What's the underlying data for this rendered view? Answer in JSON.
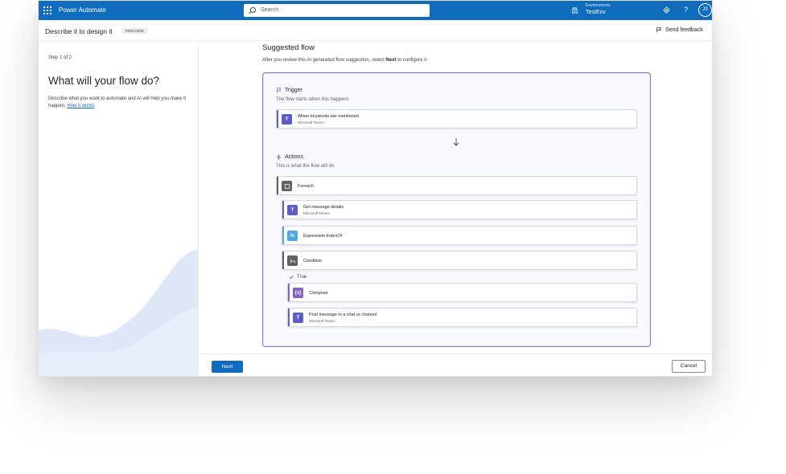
{
  "topbar": {
    "app_title": "Power Automate",
    "search_placeholder": "Search",
    "environments_label": "Environments",
    "environment_name": "TestEnv",
    "help_glyph": "?",
    "avatar_initials": "JS"
  },
  "header": {
    "page_title": "Describe it to design it",
    "preview_badge": "PREVIEW",
    "feedback_label": "Send feedback"
  },
  "left": {
    "step": "Step 1 of 2",
    "question": "What will your flow do?",
    "description": "Describe what you want to automate and AI will help you make it happen.",
    "link": "How it works"
  },
  "main": {
    "title": "Suggested flow",
    "subtitle_before": "After you review this AI generated flow suggestion, select ",
    "subtitle_bold": "Next",
    "subtitle_after": " to configure it"
  },
  "trigger": {
    "heading": "Trigger",
    "sub": "The flow starts when this happens",
    "card_title": "When keywords are mentioned",
    "card_sub": "Microsoft Teams"
  },
  "actions": {
    "heading": "Actions",
    "sub": "This is what the flow will do",
    "items": [
      {
        "title": "Foreach",
        "sub": ""
      },
      {
        "title": "Get message details",
        "sub": "Microsoft Teams"
      },
      {
        "title": "Expression IndexOf",
        "sub": ""
      },
      {
        "title": "Condition",
        "sub": ""
      },
      {
        "title": "Compose",
        "sub": ""
      },
      {
        "title": "Post message in a chat or channel",
        "sub": "Microsoft Teams"
      }
    ],
    "true_label": "True"
  },
  "footer": {
    "next_label": "Next",
    "cancel_label": "Cancel"
  },
  "colors": {
    "brand_blue": "#0f6cbd",
    "teams_purple": "#5b5fc7",
    "card_border": "#8a72d6",
    "control_gray": "#616161",
    "expression_blue": "#4fa6e3",
    "compose_purple": "#8661c5"
  },
  "icons": [
    "waffle-icon",
    "search-icon",
    "environment-icon",
    "settings-icon",
    "help-icon",
    "feedback-icon",
    "trigger-flag-icon",
    "actions-bolt-icon",
    "arrow-down-icon",
    "teams-icon",
    "foreach-icon",
    "expression-icon",
    "condition-icon",
    "compose-icon",
    "checkmark-icon"
  ]
}
